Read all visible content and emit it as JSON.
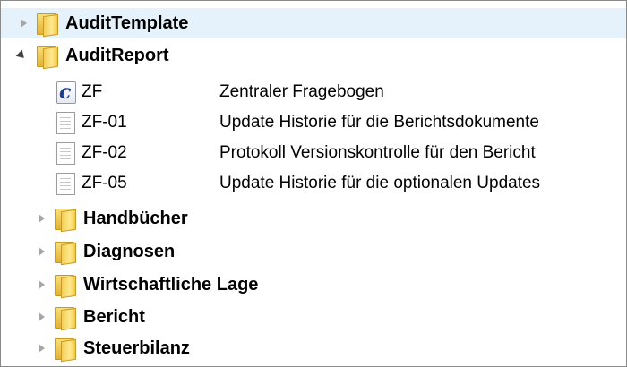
{
  "tree": {
    "nodes": [
      {
        "label": "AuditTemplate",
        "type": "folder",
        "expanded": false
      },
      {
        "label": "AuditReport",
        "type": "folder",
        "expanded": true,
        "children": [
          {
            "name": "ZF",
            "description": "Zentraler Fragebogen",
            "icon": "c-document-icon"
          },
          {
            "name": "ZF-01",
            "description": "Update Historie für die Berichtsdokumente",
            "icon": "text-document-icon"
          },
          {
            "name": "ZF-02",
            "description": "Protokoll Versionskontrolle für den Bericht",
            "icon": "text-document-icon"
          },
          {
            "name": "ZF-05",
            "description": "Update Historie für die optionalen Updates",
            "icon": "text-document-icon"
          }
        ]
      },
      {
        "label": "Handbücher",
        "type": "folder",
        "expanded": false
      },
      {
        "label": "Diagnosen",
        "type": "folder",
        "expanded": false
      },
      {
        "label": "Wirtschaftliche Lage",
        "type": "folder",
        "expanded": false
      },
      {
        "label": "Bericht",
        "type": "folder",
        "expanded": false
      },
      {
        "label": "Steuerbilanz",
        "type": "folder",
        "expanded": false
      }
    ]
  }
}
